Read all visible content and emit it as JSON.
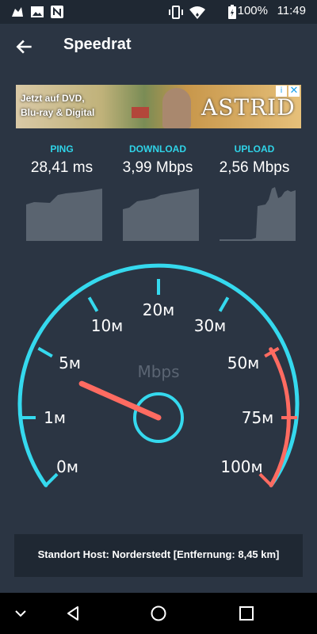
{
  "status": {
    "time": "11:49",
    "battery": "100%"
  },
  "appbar": {
    "title": "Speedrat"
  },
  "ad": {
    "text_line1": "Jetzt auf DVD,",
    "text_line2": "Blu-ray & Digital",
    "brand": "ASTRID",
    "info": "i",
    "close": "✕"
  },
  "metrics": [
    {
      "label": "PING",
      "value": "28,41 ms"
    },
    {
      "label": "DOWNLOAD",
      "value": "3,99 Mbps"
    },
    {
      "label": "UPLOAD",
      "value": "2,56 Mbps"
    }
  ],
  "gauge": {
    "unit": "Mbps",
    "ticks": [
      "0м",
      "1м",
      "5м",
      "10м",
      "20м",
      "30м",
      "50м",
      "75м",
      "100м"
    ],
    "needle_fraction": 0.255,
    "colors": {
      "arc": "#35d9ee",
      "high": "#ff6b61",
      "needle": "#ff6b61",
      "label": "#ffffff",
      "unit": "#5b6573"
    }
  },
  "footer": {
    "text": "Standort Host: Norderstedt [Entfernung: 8,45 km]"
  },
  "colors": {
    "background": "#2b3543",
    "accent": "#2fd4e8",
    "panel": "#1f2833",
    "spark": "#5a6470"
  }
}
